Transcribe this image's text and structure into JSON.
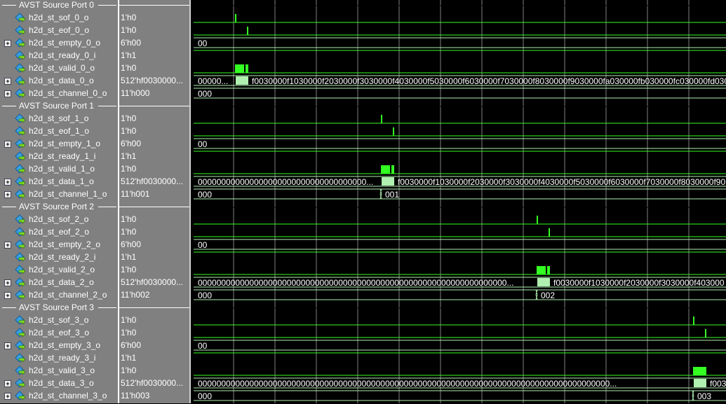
{
  "colors": {
    "signal": "#33ff22",
    "bus": "#b0f0b0",
    "grid": "#808080",
    "panel": "#808080"
  },
  "groups": [
    {
      "title": "AVST Source Port 0",
      "signals": [
        {
          "name": "h2d_st_sof_0_o",
          "value": "1'h0",
          "expandable": false
        },
        {
          "name": "h2d_st_eof_0_o",
          "value": "1'h0",
          "expandable": false
        },
        {
          "name": "h2d_st_empty_0_o",
          "value": "6'h00",
          "expandable": true
        },
        {
          "name": "h2d_st_ready_0_i",
          "value": "1'h1",
          "expandable": false
        },
        {
          "name": "h2d_st_valid_0_o",
          "value": "1'h0",
          "expandable": false
        },
        {
          "name": "h2d_st_data_0_o",
          "value": "512'hf0030000...",
          "expandable": true
        },
        {
          "name": "h2d_st_channel_0_o",
          "value": "11'h000",
          "expandable": true
        }
      ],
      "wave": {
        "empty": "00",
        "data_before": "00000...",
        "data_after": "f0030000f1030000f2030000f3030000f4030000f5030000f6030000f7030000f8030000f9030000fa030000fb030000fc030000fd030000",
        "channel_before": "000",
        "channel_after": ""
      }
    },
    {
      "title": "AVST Source Port 1",
      "signals": [
        {
          "name": "h2d_st_sof_1_o",
          "value": "1'h0",
          "expandable": false
        },
        {
          "name": "h2d_st_eof_1_o",
          "value": "1'h0",
          "expandable": false
        },
        {
          "name": "h2d_st_empty_1_o",
          "value": "6'h00",
          "expandable": true
        },
        {
          "name": "h2d_st_ready_1_i",
          "value": "1'h1",
          "expandable": false
        },
        {
          "name": "h2d_st_valid_1_o",
          "value": "1'h0",
          "expandable": false
        },
        {
          "name": "h2d_st_data_1_o",
          "value": "512'hf0030000...",
          "expandable": true
        },
        {
          "name": "h2d_st_channel_1_o",
          "value": "11'h001",
          "expandable": true
        }
      ],
      "wave": {
        "empty": "00",
        "data_before": "000000000000000000000000000000000000...",
        "data_after": "f0030000f1030000f2030000f3030000f4030000f5030000f6030000f7030000f8030000f90",
        "channel_before": "000",
        "channel_after": "001"
      }
    },
    {
      "title": "AVST Source Port 2",
      "signals": [
        {
          "name": "h2d_st_sof_2_o",
          "value": "1'h0",
          "expandable": false
        },
        {
          "name": "h2d_st_eof_2_o",
          "value": "1'h0",
          "expandable": false
        },
        {
          "name": "h2d_st_empty_2_o",
          "value": "6'h00",
          "expandable": true
        },
        {
          "name": "h2d_st_ready_2_i",
          "value": "1'h1",
          "expandable": false
        },
        {
          "name": "h2d_st_valid_2_o",
          "value": "1'h0",
          "expandable": false
        },
        {
          "name": "h2d_st_data_2_o",
          "value": "512'hf0030000...",
          "expandable": true
        },
        {
          "name": "h2d_st_channel_2_o",
          "value": "11'h002",
          "expandable": true
        }
      ],
      "wave": {
        "empty": "00",
        "data_before": "000000000000000000000000000000000000000000000000000000000000000000...",
        "data_after": "f0030000f1030000f2030000f3030000f403000",
        "channel_before": "000",
        "channel_after": "002"
      }
    },
    {
      "title": "AVST Source Port 3",
      "signals": [
        {
          "name": "h2d_st_sof_3_o",
          "value": "1'h0",
          "expandable": false
        },
        {
          "name": "h2d_st_eof_3_o",
          "value": "1'h0",
          "expandable": false
        },
        {
          "name": "h2d_st_empty_3_o",
          "value": "6'h00",
          "expandable": true
        },
        {
          "name": "h2d_st_ready_3_i",
          "value": "1'h1",
          "expandable": false
        },
        {
          "name": "h2d_st_valid_3_o",
          "value": "1'h0",
          "expandable": false
        },
        {
          "name": "h2d_st_data_3_o",
          "value": "512'hf0030000...",
          "expandable": true
        },
        {
          "name": "h2d_st_channel_3_o",
          "value": "11'h003",
          "expandable": true
        }
      ],
      "wave": {
        "empty": "00",
        "data_before": "0000000000000000000000000000000000000000000000000000000000000000000000000000000000000000...",
        "data_after": "f003",
        "channel_before": "000",
        "channel_after": "003"
      }
    }
  ]
}
